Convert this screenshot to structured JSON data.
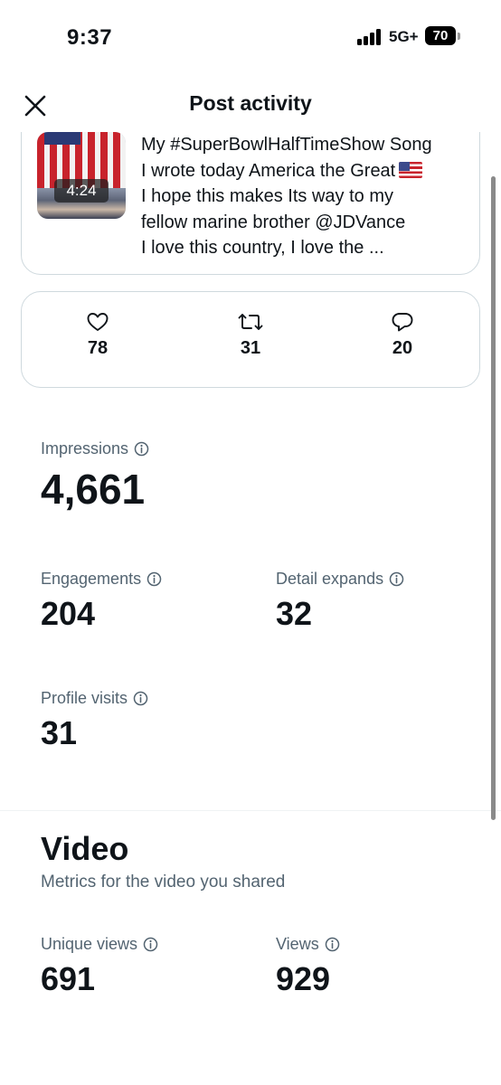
{
  "status_bar": {
    "time": "9:37",
    "network": "5G+",
    "battery": "70"
  },
  "header": {
    "title": "Post activity",
    "close_icon": "close-icon"
  },
  "post": {
    "video_duration": "4:24",
    "lines": [
      "My #SuperBowlHalfTimeShow Song",
      "I wrote today America the Great",
      "I hope this makes Its way to my",
      "fellow marine brother  @JDVance",
      "I love this country, I love the ..."
    ],
    "emoji": "us-flag-emoji"
  },
  "engagement": {
    "likes": "78",
    "reposts": "31",
    "replies": "20",
    "icons": [
      "heart-icon",
      "repost-icon",
      "reply-icon"
    ]
  },
  "metrics": {
    "impressions_label": "Impressions",
    "impressions_value": "4,661",
    "engagements_label": "Engagements",
    "engagements_value": "204",
    "detail_expands_label": "Detail expands",
    "detail_expands_value": "32",
    "profile_visits_label": "Profile visits",
    "profile_visits_value": "31"
  },
  "video": {
    "title": "Video",
    "subtitle": "Metrics for the video you shared",
    "unique_views_label": "Unique views",
    "unique_views_value": "691",
    "views_label": "Views",
    "views_value": "929"
  },
  "colors": {
    "text_primary": "#0f1419",
    "text_secondary": "#536471",
    "border": "#cfd9de"
  }
}
